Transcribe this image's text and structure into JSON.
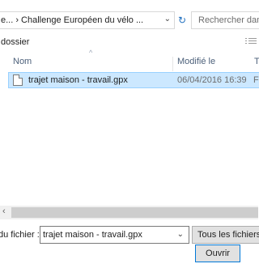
{
  "address_bar": {
    "path": "e... › Challenge Européen du vélo ...",
    "chevron": "⌄"
  },
  "search": {
    "placeholder": "Rechercher dans : C"
  },
  "toolbar": {
    "folder_label": "dossier"
  },
  "columns": {
    "name": "Nom",
    "modified": "Modifié le",
    "type": "T"
  },
  "files": [
    {
      "name": "trajet maison - travail.gpx",
      "modified": "06/04/2016 16:39",
      "type": "F",
      "icon": "document-icon"
    }
  ],
  "footer": {
    "filename_label": "du fichier :",
    "filename_value": "trajet maison - travail.gpx",
    "filetype_value": "Tous les fichiers",
    "open_label": "Ouvrir"
  },
  "colors": {
    "selection": "#cce8ff",
    "selection_border": "#99d1ff",
    "accent": "#0078d7"
  }
}
